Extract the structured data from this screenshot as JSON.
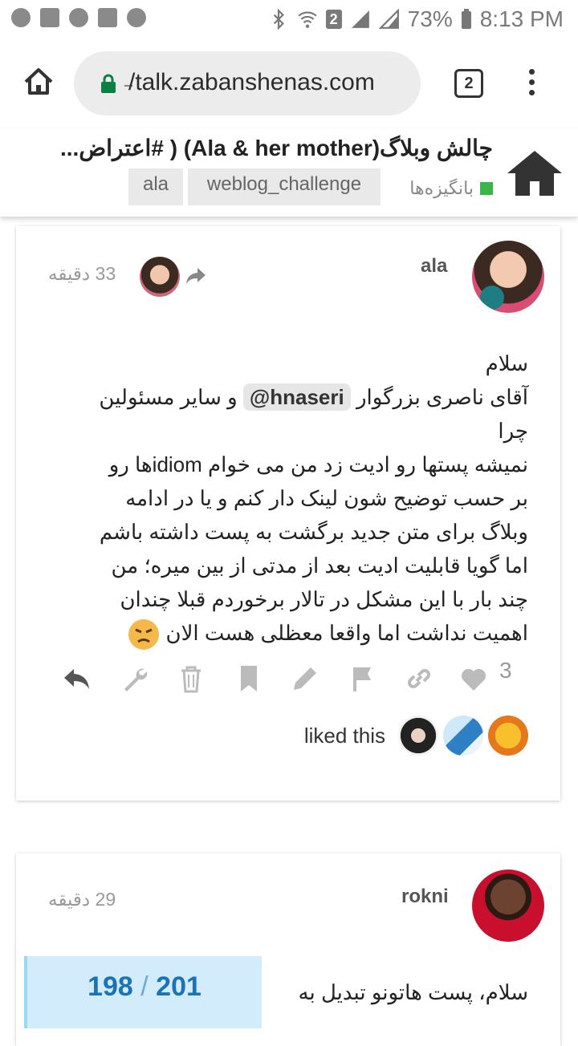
{
  "statusbar": {
    "sim_number": "2",
    "battery": "73%",
    "time": "8:13 PM"
  },
  "browser": {
    "url_prefix": "̵",
    "url_host": "/talk.zabanshenas.com",
    "tab_count": "2"
  },
  "topic": {
    "title": "چالش وبلاگ(Ala & her mother) ( #اعتراض...",
    "category": "بانگیزه‌ها",
    "category_color": "#3ab54a",
    "tags": [
      "ala",
      "weblog_challenge"
    ]
  },
  "posts": [
    {
      "username": "ala",
      "time": "33 دقیقه",
      "body_lines": [
        "سلام",
        "آقای ناصری بزرگوار",
        "@hnaseri",
        "و سایر مسئولین چرا",
        "نمیشه پستها رو ادیت زد من می خوام idiomها رو",
        "بر حسب توضیح شون لینک دار کنم و یا در ادامه",
        "وبلاگ برای متن جدید برگشت به پست داشته باشم",
        "اما گویا قابلیت ادیت بعد از مدتی از بین میره؛ من",
        "چند بار با این مشکل در تالار برخوردم قبلا چندان",
        "اهمیت نداشت اما واقعا معظلی هست الان"
      ],
      "like_count": "3",
      "liked_text": "liked this"
    },
    {
      "username": "rokni",
      "time": "29 دقیقه",
      "body_text": "سلام، پست هاتونو تبدیل به",
      "progress_current": "198",
      "progress_total": "201",
      "progress_separator": "/"
    }
  ]
}
